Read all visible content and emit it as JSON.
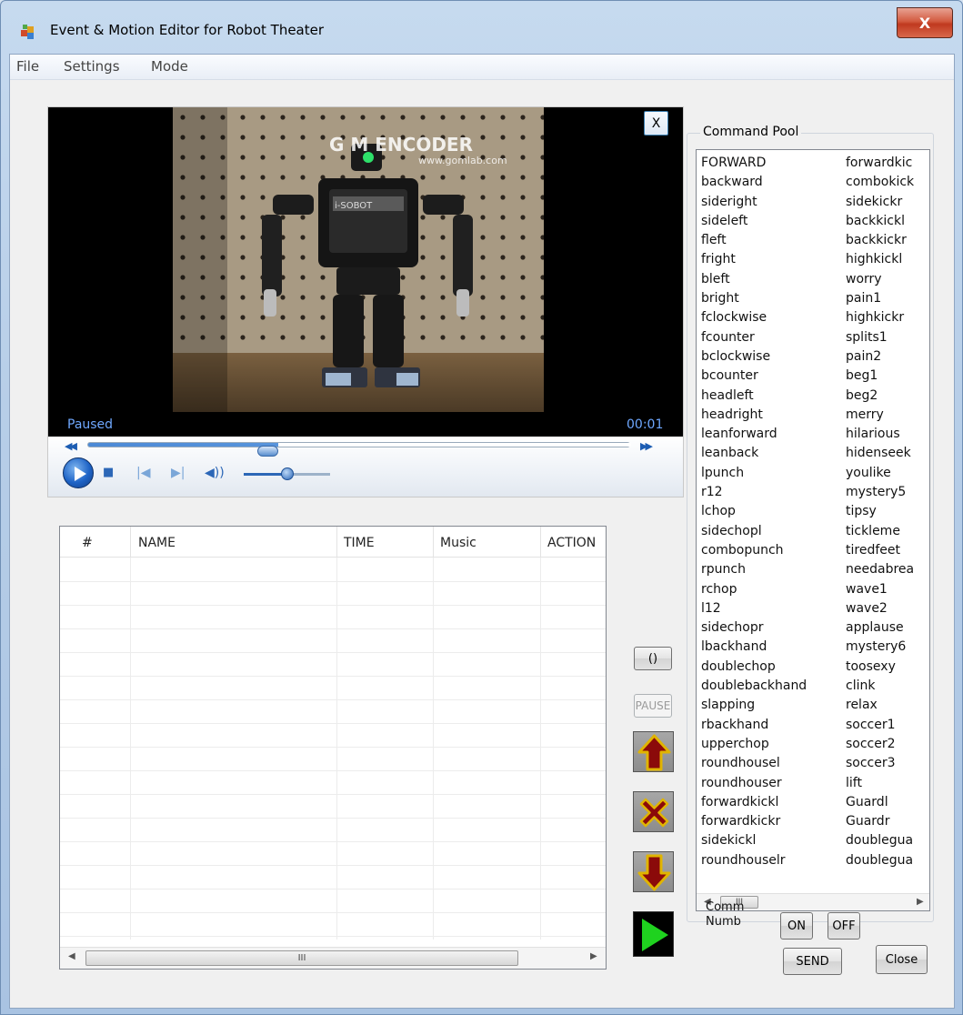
{
  "window": {
    "title": "Event & Motion Editor for Robot Theater",
    "close_label": "X"
  },
  "menu": [
    "File",
    "Settings",
    "Mode"
  ],
  "player": {
    "close_label": "X",
    "overlay_brand": "G M ENCODER",
    "overlay_url": "www.gomlab.com",
    "robot_brand": "i-SOBOT",
    "status": "Paused",
    "time": "00:01",
    "seek_fraction": 0.33,
    "volume_fraction": 0.5
  },
  "event_table": {
    "columns": [
      "#",
      "NAME",
      "TIME",
      "Music",
      "ACTION"
    ],
    "rows": [],
    "scroll_label": "III"
  },
  "command_pool": {
    "title": "Command Pool",
    "col1": [
      "FORWARD",
      "backward",
      "sideright",
      "sideleft",
      "fleft",
      "fright",
      "bleft",
      "bright",
      "fclockwise",
      "fcounter",
      "bclockwise",
      "bcounter",
      "headleft",
      "headright",
      "leanforward",
      "leanback",
      "lpunch",
      "r12",
      "lchop",
      "sidechopl",
      "combopunch",
      "rpunch",
      "rchop",
      "l12",
      "sidechopr",
      "lbackhand",
      "doublechop",
      "doublebackhand",
      "slapping",
      "rbackhand",
      "upperchop",
      "roundhousel",
      "roundhouser",
      "forwardkickl",
      "forwardkickr",
      "sidekickl",
      "roundhouselr"
    ],
    "col2": [
      "forwardkic",
      "combokick",
      "sidekickr",
      "backkickl",
      "backkickr",
      "highkickl",
      "worry",
      "pain1",
      "highkickr",
      "splits1",
      "pain2",
      "beg1",
      "beg2",
      "merry",
      "hilarious",
      "hidenseek",
      "youlike",
      "mystery5",
      "tipsy",
      "tickleme",
      "tiredfeet",
      "needabrea",
      "wave1",
      "wave2",
      "applause",
      "mystery6",
      "toosexy",
      "clink",
      "relax",
      "soccer1",
      "soccer2",
      "soccer3",
      "lift",
      "Guardl",
      "Guardr",
      "doublegua",
      "doublegua"
    ],
    "scroll_label": "III"
  },
  "side_controls": {
    "paren_label": "()",
    "pause_label": "PAUSE"
  },
  "bottom": {
    "comm_label": "Comm",
    "numb_label": "Numb",
    "on_label": "ON",
    "off_label": "OFF",
    "send_label": "SEND",
    "close_label": "Close"
  },
  "colors": {
    "arrow_red": "#8b0a0a",
    "arrow_gold": "#e0b400",
    "play_green": "#1fd21f",
    "status_blue": "#6fa8ff"
  }
}
